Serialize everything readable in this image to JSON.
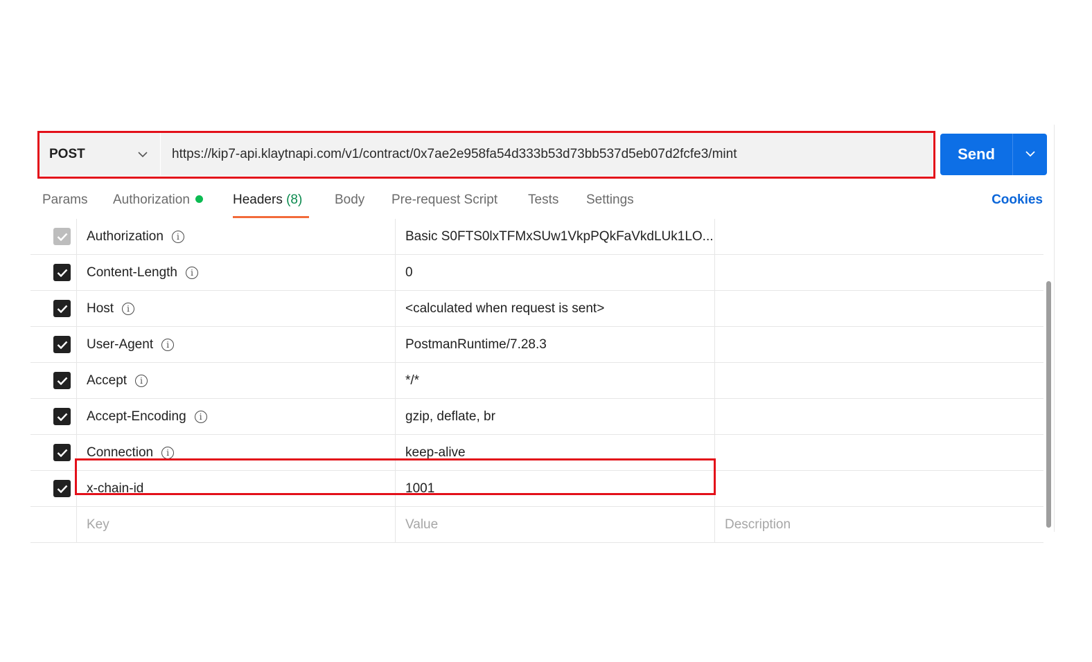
{
  "request": {
    "method": "POST",
    "url": "https://kip7-api.klaytnapi.com/v1/contract/0x7ae2e958fa54d333b53d73bb537d5eb07d2fcfe3/mint",
    "send_label": "Send"
  },
  "tabs": [
    {
      "label": "Params"
    },
    {
      "label": "Authorization"
    },
    {
      "label": "Headers",
      "count": "(8)"
    },
    {
      "label": "Body"
    },
    {
      "label": "Pre-request Script"
    },
    {
      "label": "Tests"
    },
    {
      "label": "Settings"
    }
  ],
  "cookies_label": "Cookies",
  "headers": [
    {
      "key": "Authorization",
      "value": "Basic S0FTS0lxTFMxSUw1VkpPQkFaVkdLUk1LO...",
      "checked": true,
      "disabled": true
    },
    {
      "key": "Content-Length",
      "value": "0",
      "checked": true
    },
    {
      "key": "Host",
      "value": "<calculated when request is sent>",
      "checked": true
    },
    {
      "key": "User-Agent",
      "value": "PostmanRuntime/7.28.3",
      "checked": true
    },
    {
      "key": "Accept",
      "value": "*/*",
      "checked": true
    },
    {
      "key": "Accept-Encoding",
      "value": "gzip, deflate, br",
      "checked": true
    },
    {
      "key": "Connection",
      "value": "keep-alive",
      "checked": true
    },
    {
      "key": "x-chain-id",
      "value": "1001",
      "checked": true
    }
  ],
  "new_row": {
    "key_placeholder": "Key",
    "value_placeholder": "Value",
    "description_placeholder": "Description"
  },
  "colors": {
    "send": "#0d6fe6",
    "highlight": "#e3101a",
    "active_tab_underline": "#f26b3a",
    "auth_dot": "#0cbb52",
    "header_count": "#0b8a4e",
    "cookies": "#0b66d9"
  },
  "icons": {
    "method_dropdown": "chevron-down-icon",
    "send_dropdown": "chevron-down-icon",
    "header_info": "info-icon",
    "checkbox": "check-icon"
  }
}
